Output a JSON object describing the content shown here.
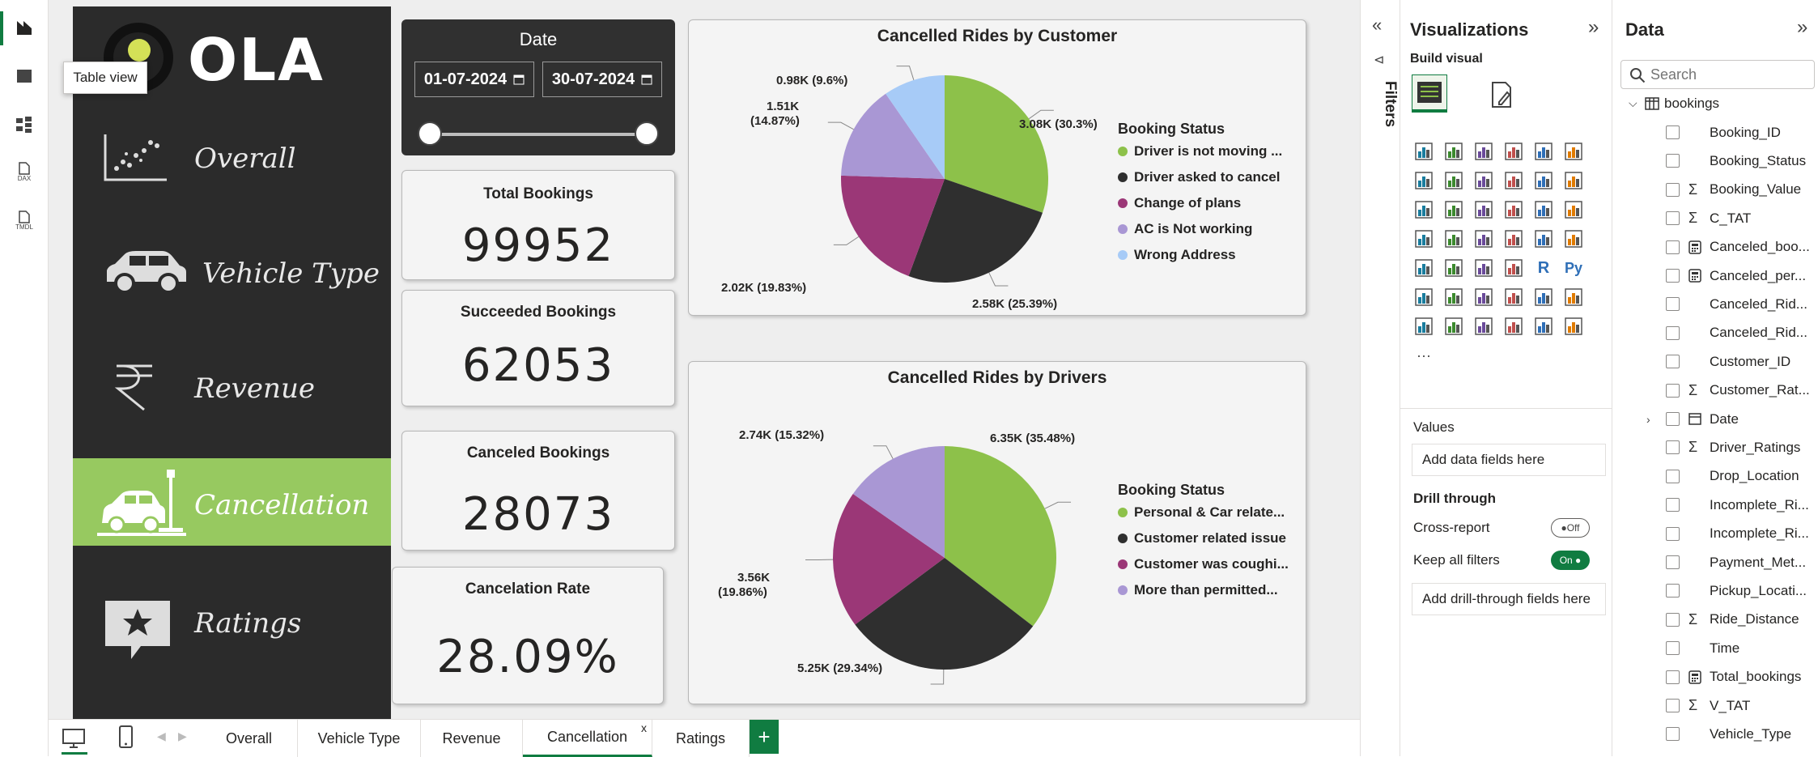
{
  "rail": {
    "tooltip": "Table view",
    "items": [
      "report-icon",
      "table-icon",
      "model-icon",
      "dax-icon",
      "tmdl-icon"
    ],
    "dax_label": "DAX",
    "tmdl_label": "TMDL"
  },
  "logo": {
    "text": "OLA"
  },
  "nav": [
    {
      "label": "Overall",
      "icon": "scatter-icon"
    },
    {
      "label": "Vehicle Type",
      "icon": "car-icon"
    },
    {
      "label": "Revenue",
      "icon": "rupee-icon"
    },
    {
      "label": "Cancellation",
      "icon": "car-crash-icon",
      "active": true
    },
    {
      "label": "Ratings",
      "icon": "star-icon"
    }
  ],
  "date": {
    "title": "Date",
    "start": "01-07-2024",
    "end": "30-07-2024"
  },
  "kpis": [
    {
      "title": "Total Bookings",
      "value": "99952"
    },
    {
      "title": "Succeeded Bookings",
      "value": "62053"
    },
    {
      "title": "Canceled Bookings",
      "value": "28073"
    },
    {
      "title": "Cancelation Rate",
      "value": "28.09%"
    }
  ],
  "colors": {
    "green": "#8dc14a",
    "black": "#2f2f2f",
    "plum": "#9b3777",
    "lavender": "#a997d4",
    "lightblue": "#a7cbf7",
    "accent": "#107c41"
  },
  "pie1": {
    "title": "Cancelled Rides by Customer",
    "legend_title": "Booking Status",
    "legend": [
      "Driver is not moving ...",
      "Driver asked to cancel",
      "Change of plans",
      "AC is Not working",
      "Wrong Address"
    ],
    "labels": [
      "3.08K (30.3%)",
      "2.58K (25.39%)",
      "2.02K (19.83%)",
      "1.51K",
      "(14.87%)",
      "0.98K (9.6%)"
    ]
  },
  "pie2": {
    "title": "Cancelled Rides by Drivers",
    "legend_title": "Booking Status",
    "legend": [
      "Personal & Car relate...",
      "Customer related issue",
      "Customer was coughi...",
      "More than permitted..."
    ],
    "labels": [
      "6.35K (35.48%)",
      "5.25K (29.34%)",
      "3.56K",
      "(19.86%)",
      "2.74K (15.32%)"
    ]
  },
  "chart_data": [
    {
      "type": "pie",
      "title": "Cancelled Rides by Customer",
      "legend_title": "Booking Status",
      "categories": [
        "Driver is not moving ...",
        "Driver asked to cancel",
        "Change of plans",
        "AC is Not working",
        "Wrong Address"
      ],
      "values": [
        3.08,
        2.58,
        2.02,
        1.51,
        0.98
      ],
      "percent": [
        30.3,
        25.39,
        19.83,
        14.87,
        9.6
      ]
    },
    {
      "type": "pie",
      "title": "Cancelled Rides by Drivers",
      "legend_title": "Booking Status",
      "categories": [
        "Personal & Car relate...",
        "Customer related issue",
        "Customer was coughi...",
        "More than permitted..."
      ],
      "values": [
        6.35,
        5.25,
        3.56,
        2.74
      ],
      "percent": [
        35.48,
        29.34,
        19.86,
        15.32
      ]
    }
  ],
  "tabs": [
    "Overall",
    "Vehicle Type",
    "Revenue",
    "Cancellation",
    "Ratings"
  ],
  "tabs_add": "+",
  "tabs_close": "x",
  "filters": {
    "label": "Filters"
  },
  "viz": {
    "title": "Visualizations",
    "build": "Build visual",
    "values_label": "Values",
    "values_placeholder": "Add data fields here",
    "drill": "Drill through",
    "cross_report": "Cross-report",
    "cross_state": "Off",
    "keep_filters": "Keep all filters",
    "keep_state": "On",
    "drill_placeholder": "Add drill-through fields here",
    "icons": [
      "stacked-bar-icon",
      "stacked-column-icon",
      "clustered-bar-icon",
      "clustered-column-icon",
      "100-bar-icon",
      "100-column-icon",
      "line-icon",
      "area-icon",
      "stacked-area-icon",
      "line-col-icon",
      "line-clustered-icon",
      "ribbon-icon",
      "waterfall-icon",
      "funnel-icon",
      "scatter-chart-icon",
      "pie-icon",
      "donut-icon",
      "treemap-icon",
      "map-icon",
      "filled-map-icon",
      "azure-map-icon",
      "gauge-icon",
      "card-icon",
      "multi-card-icon",
      "kpi-icon",
      "slicer-icon",
      "table-icon",
      "matrix-icon",
      "r-visual-icon",
      "python-visual-icon",
      "key-influencers-icon",
      "decomposition-icon",
      "qa-icon",
      "narrative-icon",
      "metrics-icon",
      "paginated-icon",
      "power-apps-icon",
      "power-automate-icon",
      "image-icon",
      "arcgis-icon",
      "diamond-icon",
      "chevrons-icon",
      "more-icon"
    ],
    "r_label": "R",
    "py_label": "Py",
    "more_label": "···"
  },
  "data": {
    "title": "Data",
    "search_placeholder": "Search",
    "table": "bookings",
    "fields": [
      {
        "name": "Booking_ID",
        "sigma": ""
      },
      {
        "name": "Booking_Status",
        "sigma": ""
      },
      {
        "name": "Booking_Value",
        "sigma": "Σ"
      },
      {
        "name": "C_TAT",
        "sigma": "Σ"
      },
      {
        "name": "Canceled_boo...",
        "sigma": "calc"
      },
      {
        "name": "Canceled_per...",
        "sigma": "calc"
      },
      {
        "name": "Canceled_Rid...",
        "sigma": ""
      },
      {
        "name": "Canceled_Rid...",
        "sigma": ""
      },
      {
        "name": "Customer_ID",
        "sigma": ""
      },
      {
        "name": "Customer_Rat...",
        "sigma": "Σ"
      },
      {
        "name": "Date",
        "sigma": "date"
      },
      {
        "name": "Driver_Ratings",
        "sigma": "Σ"
      },
      {
        "name": "Drop_Location",
        "sigma": ""
      },
      {
        "name": "Incomplete_Ri...",
        "sigma": ""
      },
      {
        "name": "Incomplete_Ri...",
        "sigma": ""
      },
      {
        "name": "Payment_Met...",
        "sigma": ""
      },
      {
        "name": "Pickup_Locati...",
        "sigma": ""
      },
      {
        "name": "Ride_Distance",
        "sigma": "Σ"
      },
      {
        "name": "Time",
        "sigma": ""
      },
      {
        "name": "Total_bookings",
        "sigma": "calc"
      },
      {
        "name": "V_TAT",
        "sigma": "Σ"
      },
      {
        "name": "Vehicle_Type",
        "sigma": ""
      }
    ]
  }
}
